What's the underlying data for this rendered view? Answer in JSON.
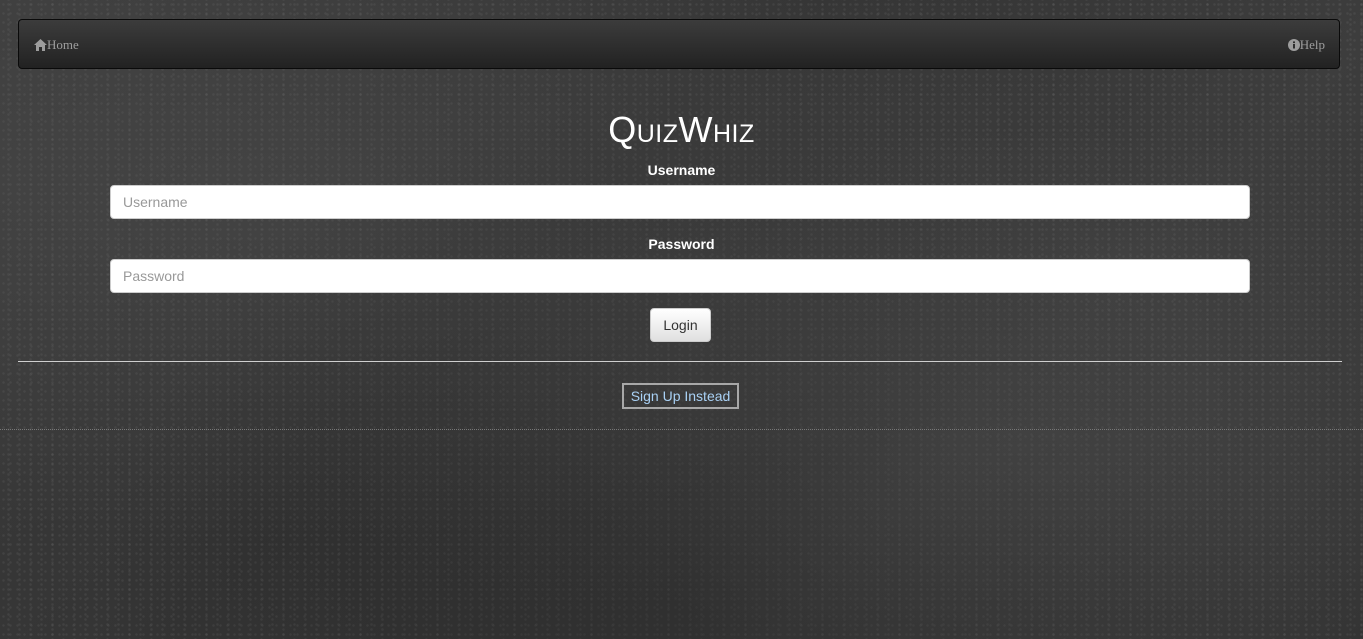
{
  "navbar": {
    "home_label": "Home",
    "home_icon": "home-icon",
    "help_label": "Help",
    "help_icon": "info-icon"
  },
  "title": "QuizWhiz",
  "form": {
    "username_label": "Username",
    "username_placeholder": "Username",
    "username_value": "",
    "password_label": "Password",
    "password_placeholder": "Password",
    "password_value": "",
    "login_label": "Login"
  },
  "signup_label": "Sign Up Instead",
  "colors": {
    "link": "#a9d1f5",
    "navbar_text": "#9d9d9d",
    "background": "#3a3a3a"
  }
}
